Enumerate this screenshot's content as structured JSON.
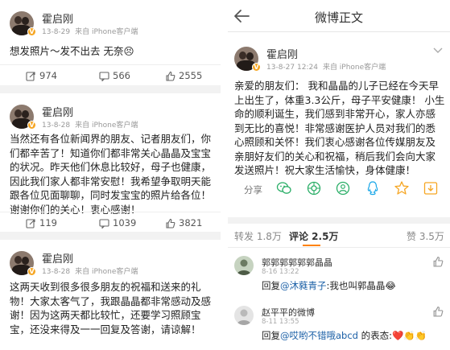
{
  "left_posts": [
    {
      "user": "霍启刚",
      "date": "13-8-29",
      "source": "来自 iPhone客户端",
      "text": "想发照片～发不出去 无奈😣",
      "repost": "974",
      "comment": "566",
      "like": "2555"
    },
    {
      "user": "霍启刚",
      "date": "13-8-28",
      "source": "来自 iPhone客户端",
      "text": "当然还有各位新闻界的朋友、记者朋友们，你们都辛苦了！知道你们都非常关心晶晶及宝宝的状况。昨天他们休息比较好，母子也健康，因此我们家人都非常安慰！我希望争取明天能跟各位见面聊聊，同时发宝宝的照片给各位！谢谢你们的关心！衷心感谢！",
      "repost": "119",
      "comment": "1039",
      "like": "3821"
    },
    {
      "user": "霍启刚",
      "date": "13-8-28",
      "source": "来自 iPhone客户端",
      "text": "这两天收到很多很多朋友的祝福和送来的礼物！大家太客气了，我跟晶晶都非常感动及感谢！因为这两天都比较忙，还要学习照顾宝宝，还没来得及一一回复及答谢，请谅解！"
    }
  ],
  "right_panel": {
    "title": "微博正文",
    "post": {
      "user": "霍启刚",
      "datetime": "13-8-27 12:24",
      "source": "来自 iPhone客户端",
      "text": "亲爱的朋友们： 我和晶晶的儿子已经在今天早上出生了，体重3.3公斤，母子平安健康！ 小生命的顺利诞生，我们感到非常开心，家人亦感到无比的喜悦！非常感谢医护人员对我们的悉心照顾和关怀！我们衷心感谢各位传媒朋友及亲朋好友们的关心和祝福，稍后我们会向大家发送照片！祝大家生活愉快，身体健康！"
    },
    "share_label": "分享",
    "share_icons": [
      "wechat-icon",
      "moments-icon",
      "friends-icon",
      "qq-icon",
      "qzone-star-icon",
      "save-icon"
    ],
    "tabs": {
      "repost": "转发 1.8万",
      "comment": "评论 2.5万",
      "like": "赞 3.5万"
    },
    "comments": [
      {
        "user": "郭郭郭郭郭郭晶晶",
        "time": "8-16 13:22",
        "prefix": "回复",
        "mention": "@沐蕤青子",
        "text": ":我也叫郭晶晶😂"
      },
      {
        "user": "赵平平的微博",
        "time": "8-11 13:55",
        "prefix": "回复",
        "mention": "@哎哟不错哦abcd",
        "text": " 的表态:❤️👏👏"
      }
    ]
  },
  "colors": {
    "accent": "#ff8200",
    "link": "#1a5fa6",
    "vbadge": "#f6a623",
    "wechat": "#2aae67",
    "qq": "#1aa7e8"
  }
}
